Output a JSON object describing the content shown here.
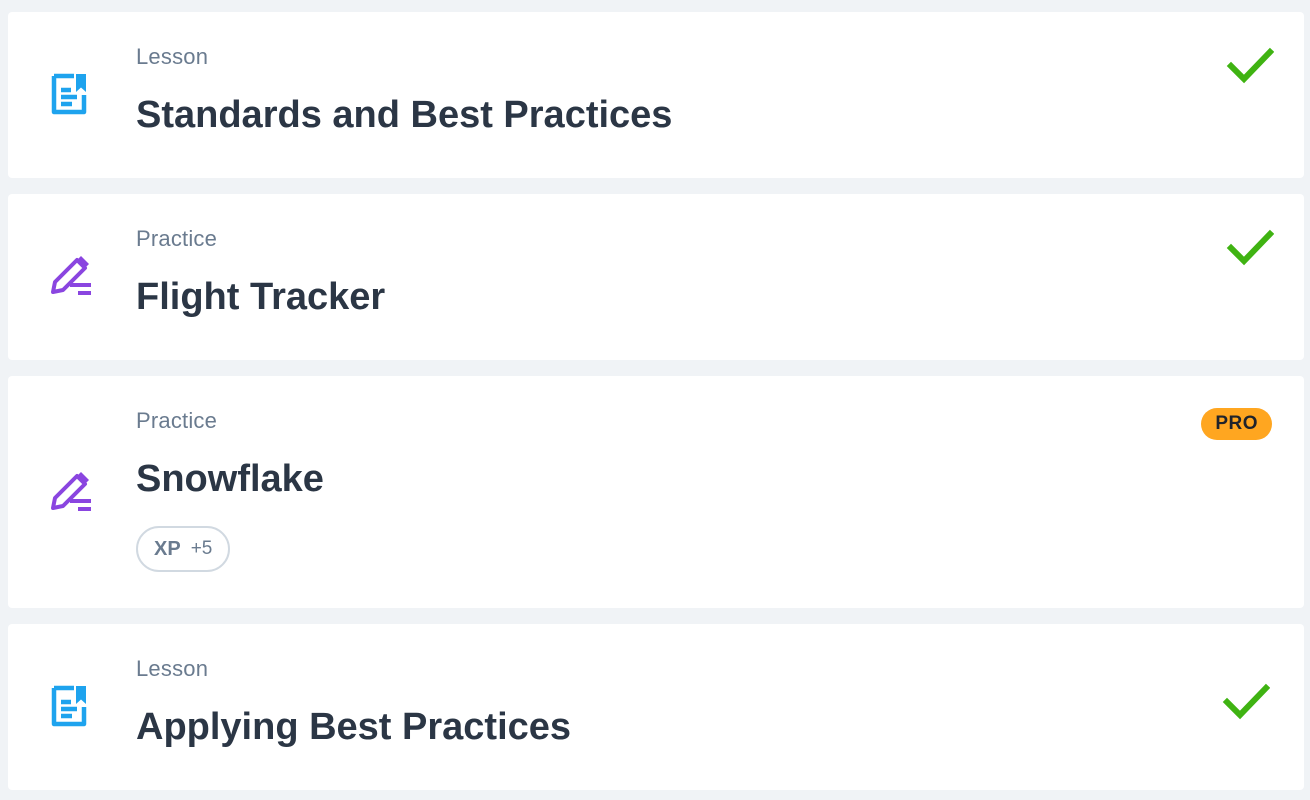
{
  "items": [
    {
      "type": "Lesson",
      "title": "Standards and Best Practices",
      "icon": "lesson-document-icon",
      "icon_color": "#1ea3ee",
      "completed": true
    },
    {
      "type": "Practice",
      "title": "Flight Tracker",
      "icon": "practice-pencil-icon",
      "icon_color": "#8a45e0",
      "completed": true
    },
    {
      "type": "Practice",
      "title": "Snowflake",
      "icon": "practice-pencil-icon",
      "icon_color": "#8a45e0",
      "completed": false,
      "badge": "PRO",
      "xp_label": "XP",
      "xp_value": "+5"
    },
    {
      "type": "Lesson",
      "title": "Applying Best Practices",
      "icon": "lesson-document-icon",
      "icon_color": "#1ea3ee",
      "completed": true
    }
  ],
  "colors": {
    "check": "#3fb312",
    "pro_badge": "#ffa620",
    "background": "#f0f3f6"
  }
}
